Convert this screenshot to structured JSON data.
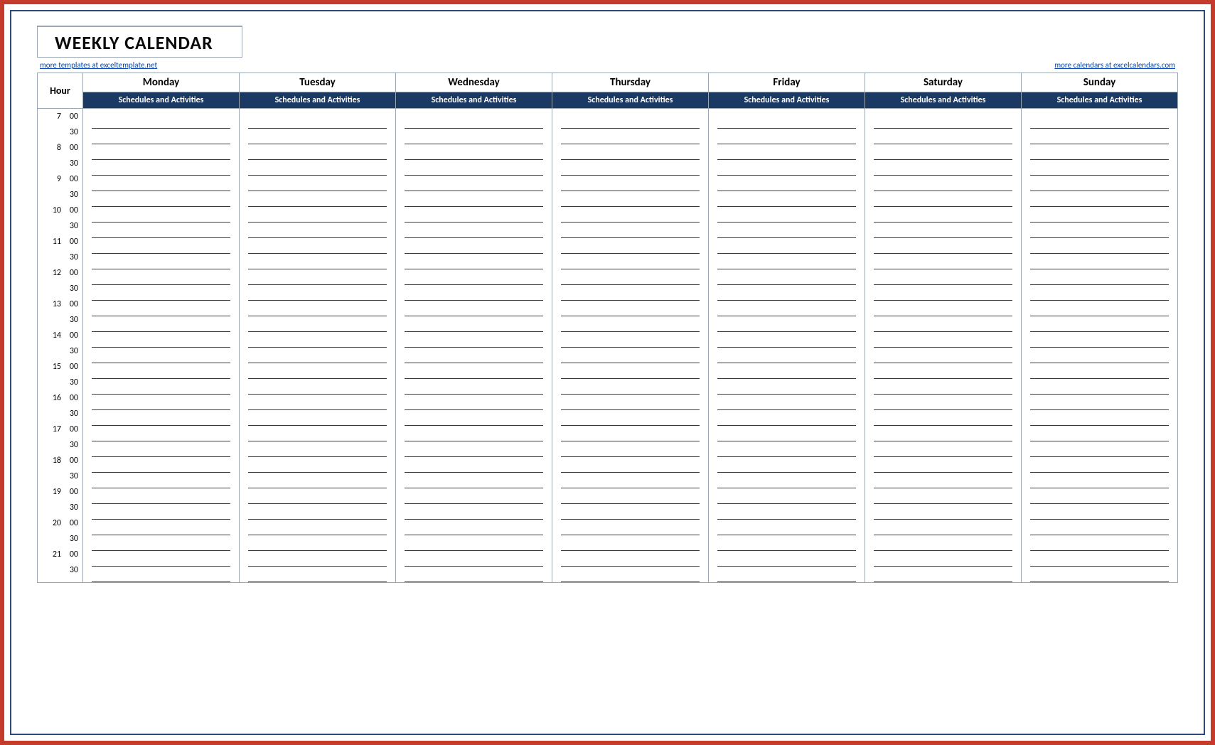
{
  "title": "WEEKLY CALENDAR",
  "link_left": "more templates at exceltemplate.net",
  "link_right": "more calendars at excelcalendars.com",
  "hour_label": "Hour",
  "sub_header": "Schedules and Activities",
  "days": [
    "Monday",
    "Tuesday",
    "Wednesday",
    "Thursday",
    "Friday",
    "Saturday",
    "Sunday"
  ],
  "hours": [
    7,
    8,
    9,
    10,
    11,
    12,
    13,
    14,
    15,
    16,
    17,
    18,
    19,
    20,
    21
  ],
  "minutes": [
    "00",
    "30"
  ]
}
